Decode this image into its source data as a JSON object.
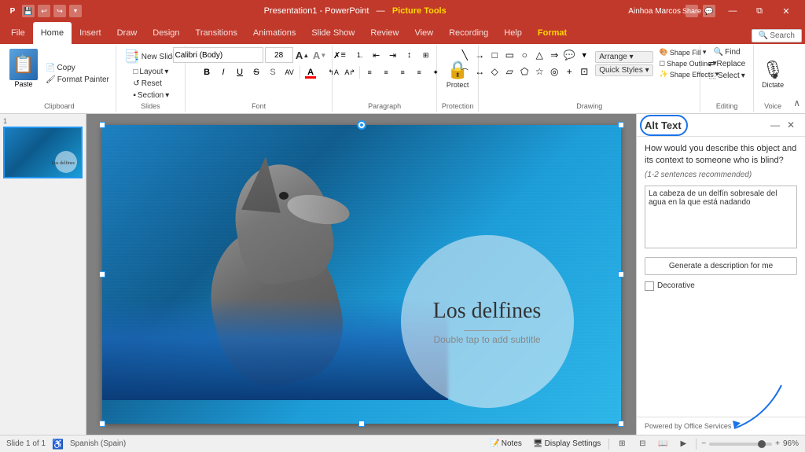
{
  "titleBar": {
    "appName": "Presentation1 - PowerPoint",
    "pictureTools": "Picture Tools",
    "user": "Ainhoa Marcos",
    "quickAccess": [
      "save",
      "undo",
      "redo",
      "customize"
    ]
  },
  "ribbonTabs": {
    "items": [
      {
        "label": "File",
        "active": false
      },
      {
        "label": "Home",
        "active": true
      },
      {
        "label": "Insert",
        "active": false
      },
      {
        "label": "Draw",
        "active": false
      },
      {
        "label": "Design",
        "active": false
      },
      {
        "label": "Transitions",
        "active": false
      },
      {
        "label": "Animations",
        "active": false
      },
      {
        "label": "Slide Show",
        "active": false
      },
      {
        "label": "Review",
        "active": false
      },
      {
        "label": "View",
        "active": false
      },
      {
        "label": "Recording",
        "active": false
      },
      {
        "label": "Help",
        "active": false
      },
      {
        "label": "Format",
        "active": false,
        "special": true
      }
    ]
  },
  "ribbon": {
    "groups": [
      {
        "label": "Clipboard"
      },
      {
        "label": "Slides"
      },
      {
        "label": "Font"
      },
      {
        "label": "Paragraph"
      },
      {
        "label": "Protection"
      },
      {
        "label": "Drawing"
      },
      {
        "label": "Editing"
      },
      {
        "label": "Voice"
      }
    ],
    "clipboard": {
      "paste": "Paste",
      "copy": "Copy",
      "formatPainter": "Format Painter"
    },
    "slides": {
      "newSlide": "New Slide",
      "layout": "Layout",
      "reset": "Reset",
      "section": "Section"
    },
    "font": {
      "fontName": "Calibri (Body)",
      "fontSize": "28",
      "bold": "B",
      "italic": "I",
      "underline": "U",
      "strikethrough": "S",
      "shadow": "S",
      "charSpacing": "AV",
      "fontColor": "A",
      "increaseFont": "A↑",
      "decreaseFont": "A↓",
      "clearFormat": "✗"
    },
    "paragraph": {
      "bullets": "≡",
      "numbering": "1.",
      "indent": "→",
      "outdent": "←",
      "lineSpacing": "↕",
      "columns": "⊞",
      "directionLTR": "↰",
      "directionRTL": "↱",
      "alignLeft": "≡",
      "alignCenter": "≡",
      "alignRight": "≡",
      "justify": "≡",
      "convertToSmart": "✦"
    },
    "protect": {
      "label": "Protect",
      "icon": "🔒"
    },
    "drawing": {
      "shapeFill": "Shape Fill",
      "shapeOutline": "Shape Outline",
      "shapeEffects": "Shape Effects",
      "arrange": "Arrange",
      "quickStyles": "Quick Styles",
      "select": "Select"
    },
    "editing": {
      "find": "Find",
      "replace": "Replace",
      "select": "Select"
    },
    "voice": {
      "dictate": "Dictate"
    }
  },
  "altTextPanel": {
    "title": "Alt Text",
    "question": "How would you describe this object and its context to someone who is blind?",
    "recommendation": "(1-2 sentences recommended)",
    "textContent": "La cabeza de un delfín sobresale del agua en la que está nadando",
    "generateBtn": "Generate a description for me",
    "decorativeLabel": "Decorative",
    "footer": "Powered by Office Services"
  },
  "slide": {
    "title": "Los delfines",
    "subtitle": "Double tap to add subtitle",
    "thumbnailAlt": "Slide 1 thumbnail"
  },
  "statusBar": {
    "slideInfo": "Slide 1 of 1",
    "language": "Spanish (Spain)",
    "notes": "Notes",
    "displaySettings": "Display Settings",
    "zoom": "96%"
  }
}
